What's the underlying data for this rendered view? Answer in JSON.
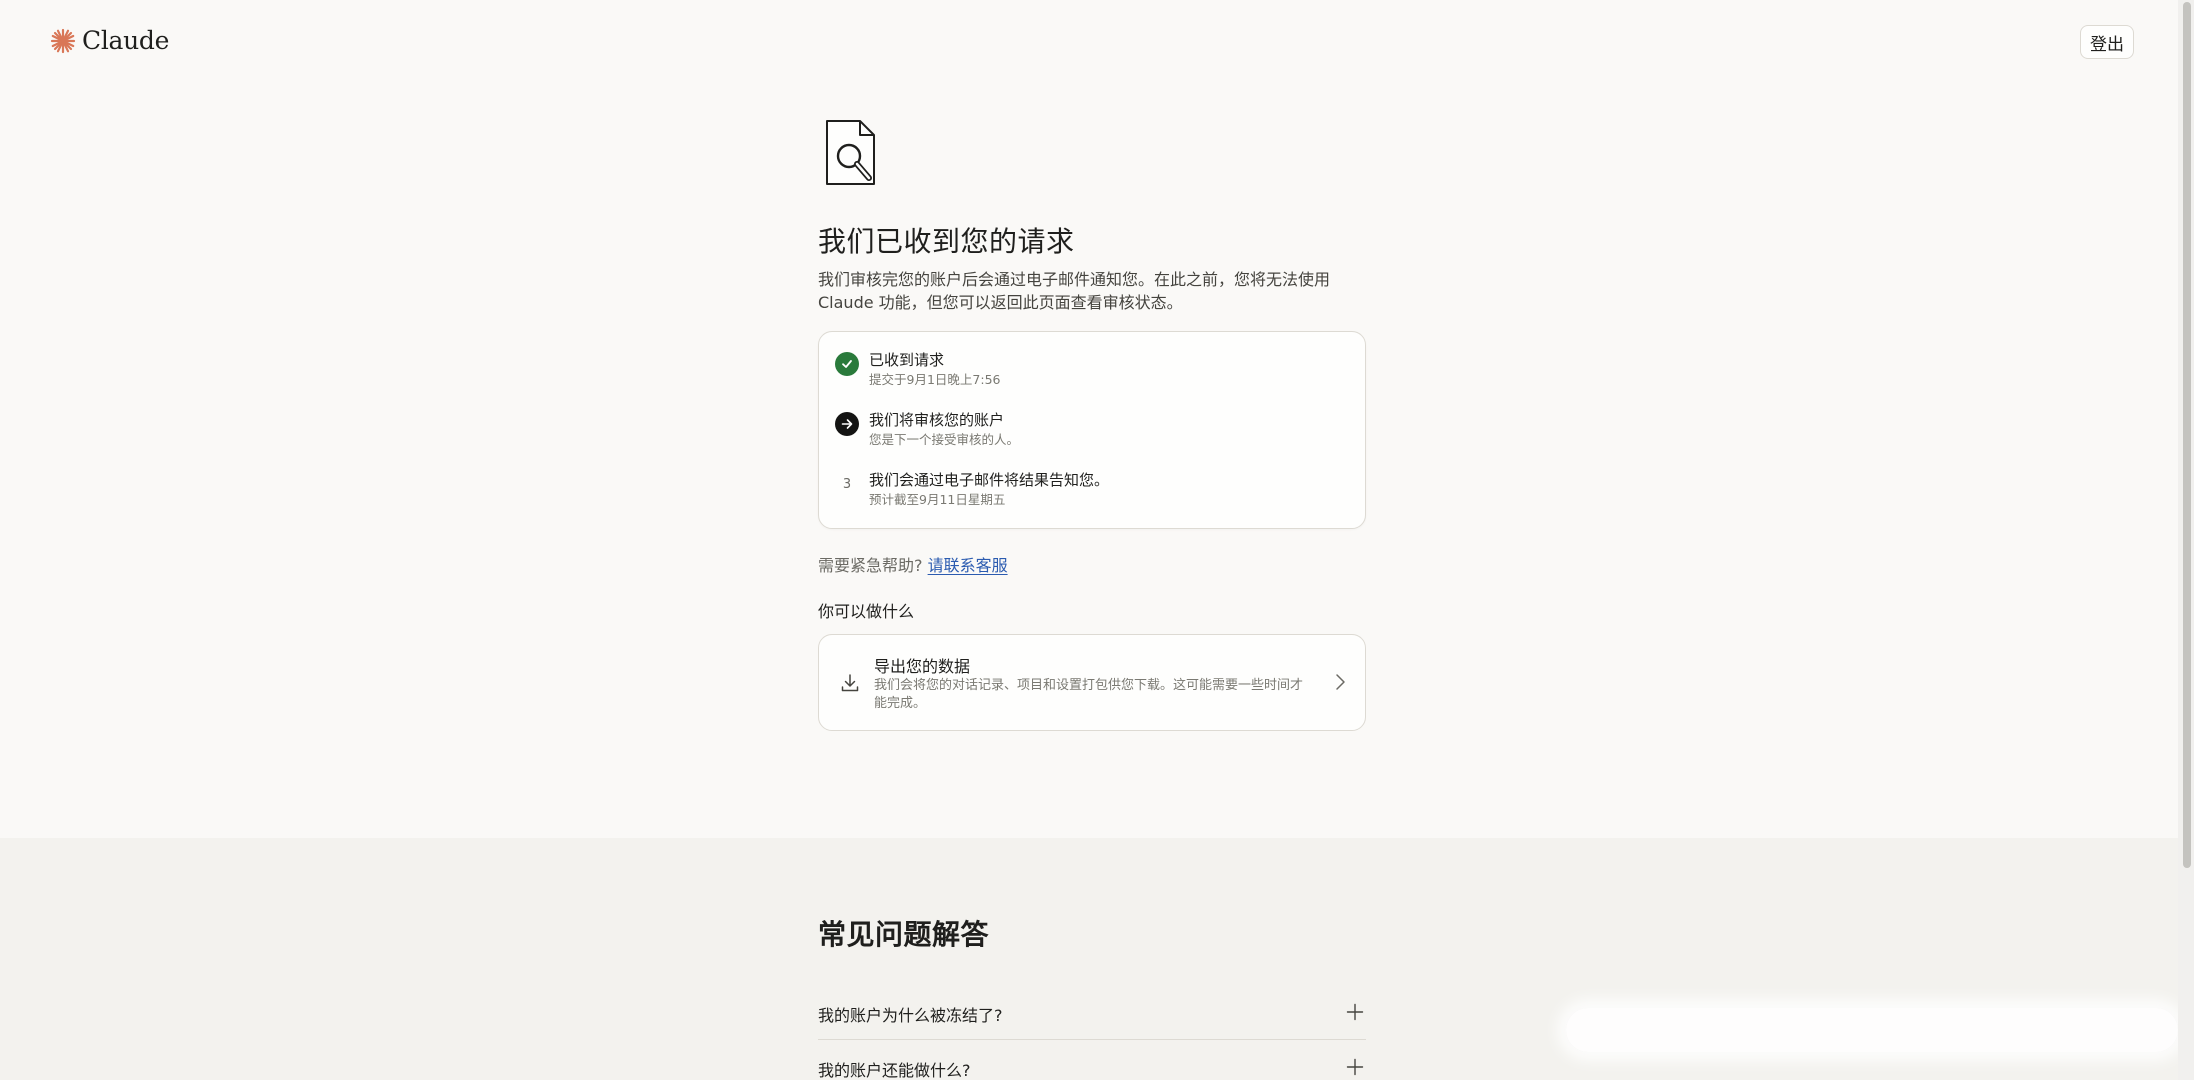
{
  "header": {
    "logo_text": "Claude",
    "logout_label": "登出",
    "brand_color": "#d97757"
  },
  "main": {
    "title": "我们已收到您的请求",
    "description": "我们审核完您的账户后会通过电子邮件通知您。在此之前，您将无法使用 Claude 功能，但您可以返回此页面查看审核状态。",
    "steps": [
      {
        "title": "已收到请求",
        "subtitle": "提交于9月1日晚上7:56",
        "state": "done",
        "icon": "check-icon"
      },
      {
        "title": "我们将审核您的账户",
        "subtitle": "您是下一个接受审核的人。",
        "state": "current",
        "icon": "arrow-right-icon"
      },
      {
        "number": "3",
        "title": "我们会通过电子邮件将结果告知您。",
        "subtitle": "预计截至9月11日星期五",
        "state": "pending"
      }
    ],
    "help_text": "需要紧急帮助?",
    "help_link": "请联系客服",
    "section_label": "你可以做什么",
    "export": {
      "title": "导出您的数据",
      "description": "我们会将您的对话记录、项目和设置打包供您下载。这可能需要一些时间才能完成。",
      "icon": "download-icon"
    }
  },
  "faq": {
    "title": "常见问题解答",
    "items": [
      {
        "question": "我的账户为什么被冻结了?"
      },
      {
        "question": "我的账户还能做什么?"
      }
    ]
  }
}
